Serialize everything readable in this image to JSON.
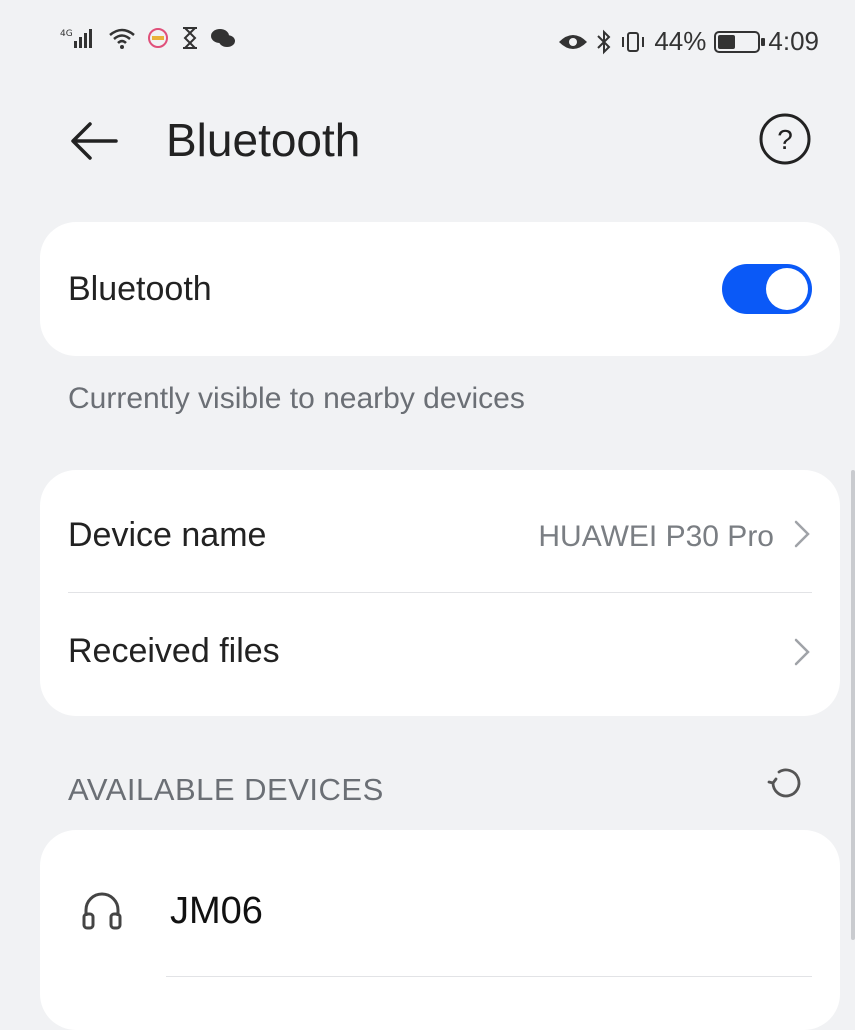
{
  "status_bar": {
    "left_icons": [
      "signal-icon",
      "wifi-icon",
      "notification-icon",
      "hourglass-icon",
      "wechat-icon"
    ],
    "right_icons": [
      "eye-comfort-icon",
      "bluetooth-icon",
      "vibrate-icon"
    ],
    "battery_percent": "44%",
    "battery_level": 0.44,
    "time": "4:09"
  },
  "header": {
    "title": "Bluetooth",
    "back_icon": "back-arrow-icon",
    "help_icon": "help-icon"
  },
  "bluetooth_card": {
    "label": "Bluetooth",
    "enabled": true
  },
  "visibility_text": "Currently visible to nearby devices",
  "info_card": {
    "device_name_label": "Device name",
    "device_name_value": "HUAWEI P30 Pro",
    "received_files_label": "Received files"
  },
  "available_devices": {
    "header": "AVAILABLE DEVICES",
    "refresh_icon": "refresh-icon",
    "items": [
      {
        "name": "JM06",
        "icon": "headphones-icon"
      }
    ]
  },
  "colors": {
    "accent": "#0a59f7",
    "background": "#f1f2f4",
    "card": "#ffffff",
    "secondary_text": "#6b6f75"
  }
}
